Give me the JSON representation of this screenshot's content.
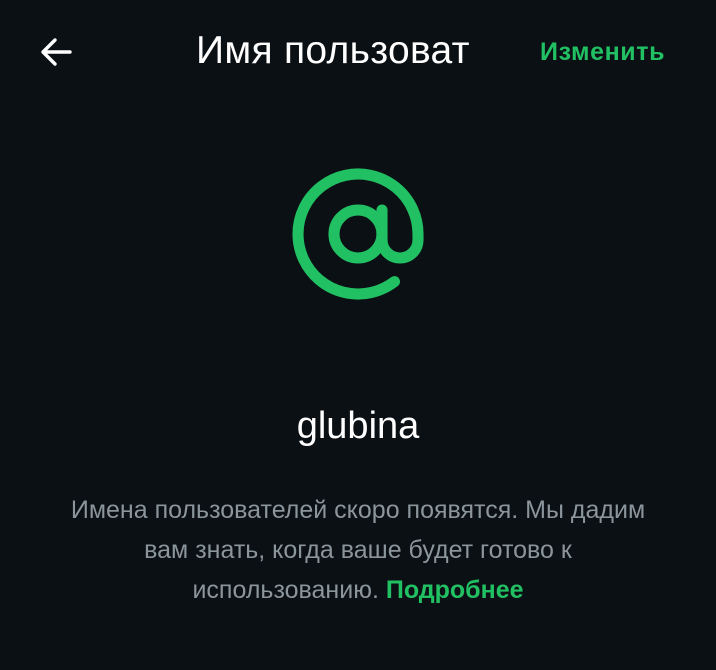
{
  "header": {
    "back_icon": "arrow-left-icon",
    "title": "Имя пользоват",
    "edit_label": "Изменить"
  },
  "profile": {
    "icon": "at-sign-icon",
    "username": "glubina"
  },
  "info": {
    "text": "Имена пользователей скоро появятся. Мы дадим вам знать, когда ваше будет готово к использованию.",
    "learn_more": "Подробнее"
  },
  "colors": {
    "background": "#0b1014",
    "accent": "#21c063",
    "primary_text": "#ffffff",
    "secondary_text": "#8b959c"
  }
}
